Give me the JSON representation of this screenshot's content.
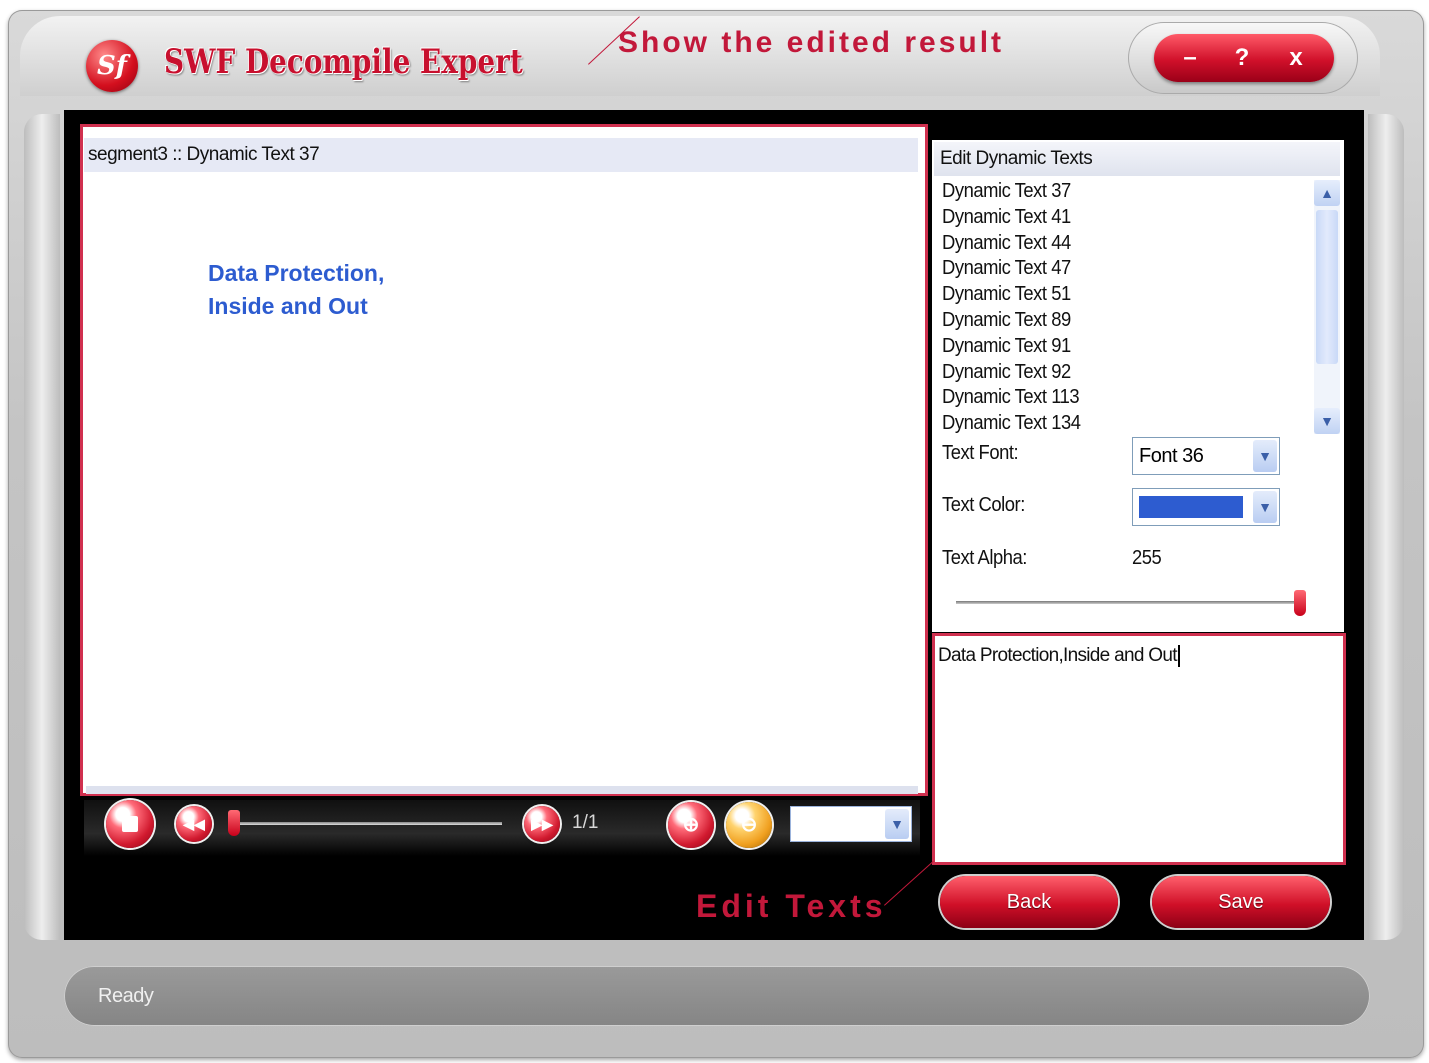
{
  "app": {
    "title": "SWF Decompile Expert",
    "logo_letters": "Sf"
  },
  "window_controls": {
    "minimize": "–",
    "help": "?",
    "close": "x"
  },
  "annotations": {
    "top_callout": "Show the edited result",
    "bottom_callout": "Edit Texts"
  },
  "preview": {
    "header": "segment3 :: Dynamic Text 37",
    "rendered_text": "Data Protection,\nInside and Out",
    "rendered_text_color": "#2d5cd0",
    "page_counter": "1/1",
    "zoom_value": ""
  },
  "side_panel": {
    "header": "Edit Dynamic Texts",
    "items": [
      "Dynamic Text 37",
      "Dynamic Text 41",
      "Dynamic Text 44",
      "Dynamic Text 47",
      "Dynamic Text 51",
      "Dynamic Text 89",
      "Dynamic Text 91",
      "Dynamic Text 92",
      "Dynamic Text 113",
      "Dynamic Text 134"
    ],
    "font_label": "Text Font:",
    "font_value": "Font 36",
    "color_label": "Text Color:",
    "color_value": "#2d5cd0",
    "alpha_label": "Text Alpha:",
    "alpha_value": "255",
    "alpha_fraction": 1.0
  },
  "editor": {
    "value": "Data Protection,Inside and Out"
  },
  "buttons": {
    "back": "Back",
    "save": "Save"
  },
  "status": {
    "text": "Ready"
  },
  "colors": {
    "accent": "#d0102a",
    "highlight_border": "#d0304f"
  }
}
